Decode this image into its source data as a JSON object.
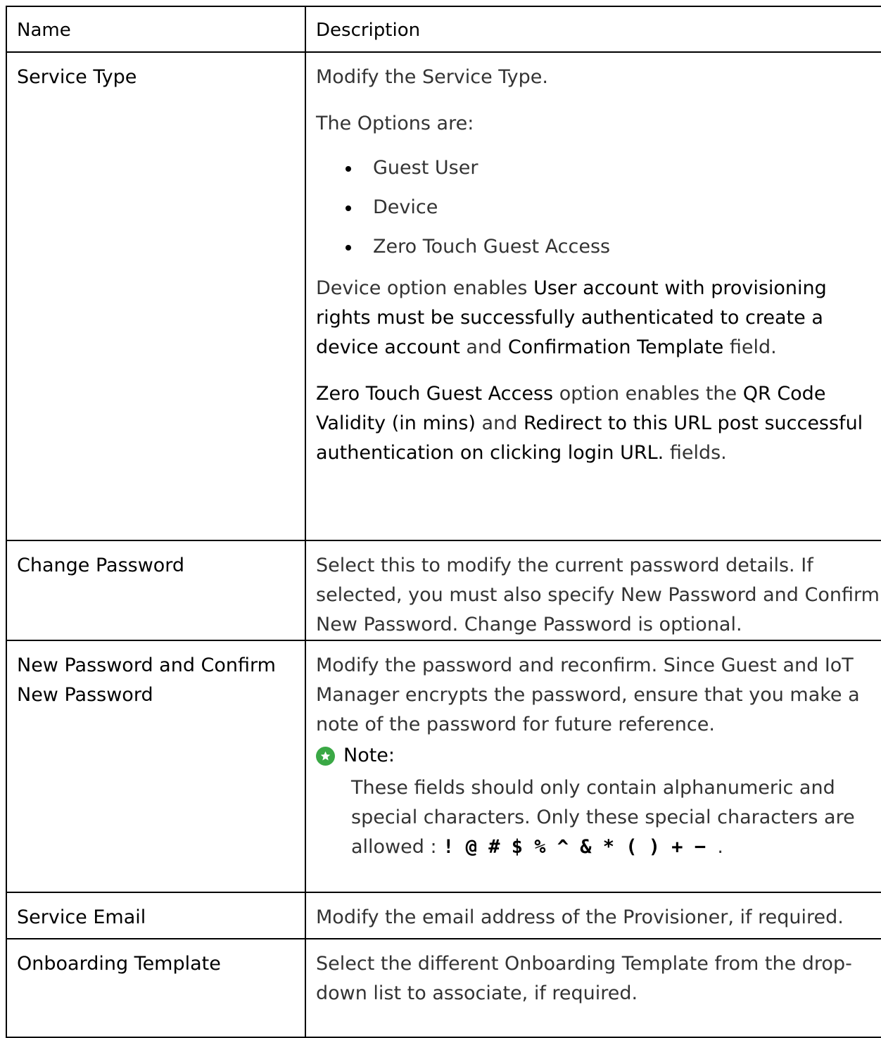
{
  "table": {
    "header": {
      "name": "Name",
      "description": "Description"
    },
    "service_type": {
      "name": "Service Type",
      "intro": "Modify the Service Type.",
      "options_intro": "The Options are:",
      "options": [
        "Guest User",
        "Device",
        "Zero Touch Guest Access"
      ],
      "device_p": {
        "lead": "Device option enables ",
        "field1": "User account with provisioning rights must be successfully authenticated to create a device account",
        "mid": " and ",
        "field2": "Confirmation Template",
        "tail": " field."
      },
      "ztga_p": {
        "lead": " Zero Touch Guest Access",
        "mid1": " option enables the ",
        "field1": "QR Code Validity (in mins)",
        "mid2": " and ",
        "field2": "Redirect to this URL post successful authentication on clicking login URL.",
        "tail": " fields."
      }
    },
    "change_password": {
      "name": "Change Password",
      "description": "Select this to modify the current password details. If selected, you must also specify New Password and Confirm New Password. Change Password is optional."
    },
    "new_password": {
      "name": "New Password and Confirm New Password",
      "description": "Modify the password and reconfirm. Since Guest and IoT Manager encrypts the password, ensure that you make a note of the password for future reference.",
      "note_label": "Note:",
      "note_text": "These fields should only contain alphanumeric and special characters. Only these special characters are allowed : ",
      "special_chars": "! @ # $ % ^ & * ( ) + − ",
      "note_end": "."
    },
    "service_email": {
      "name": "Service Email",
      "description": "Modify the email address of the Provisioner, if required."
    },
    "onboarding_template": {
      "name": "Onboarding Template",
      "description": "Select the different Onboarding Template from the drop-down list to associate, if required."
    }
  },
  "colors": {
    "border": "#000000",
    "text": "#333333",
    "note_icon": "#3aa845"
  },
  "icons": {
    "note": "star-icon"
  }
}
